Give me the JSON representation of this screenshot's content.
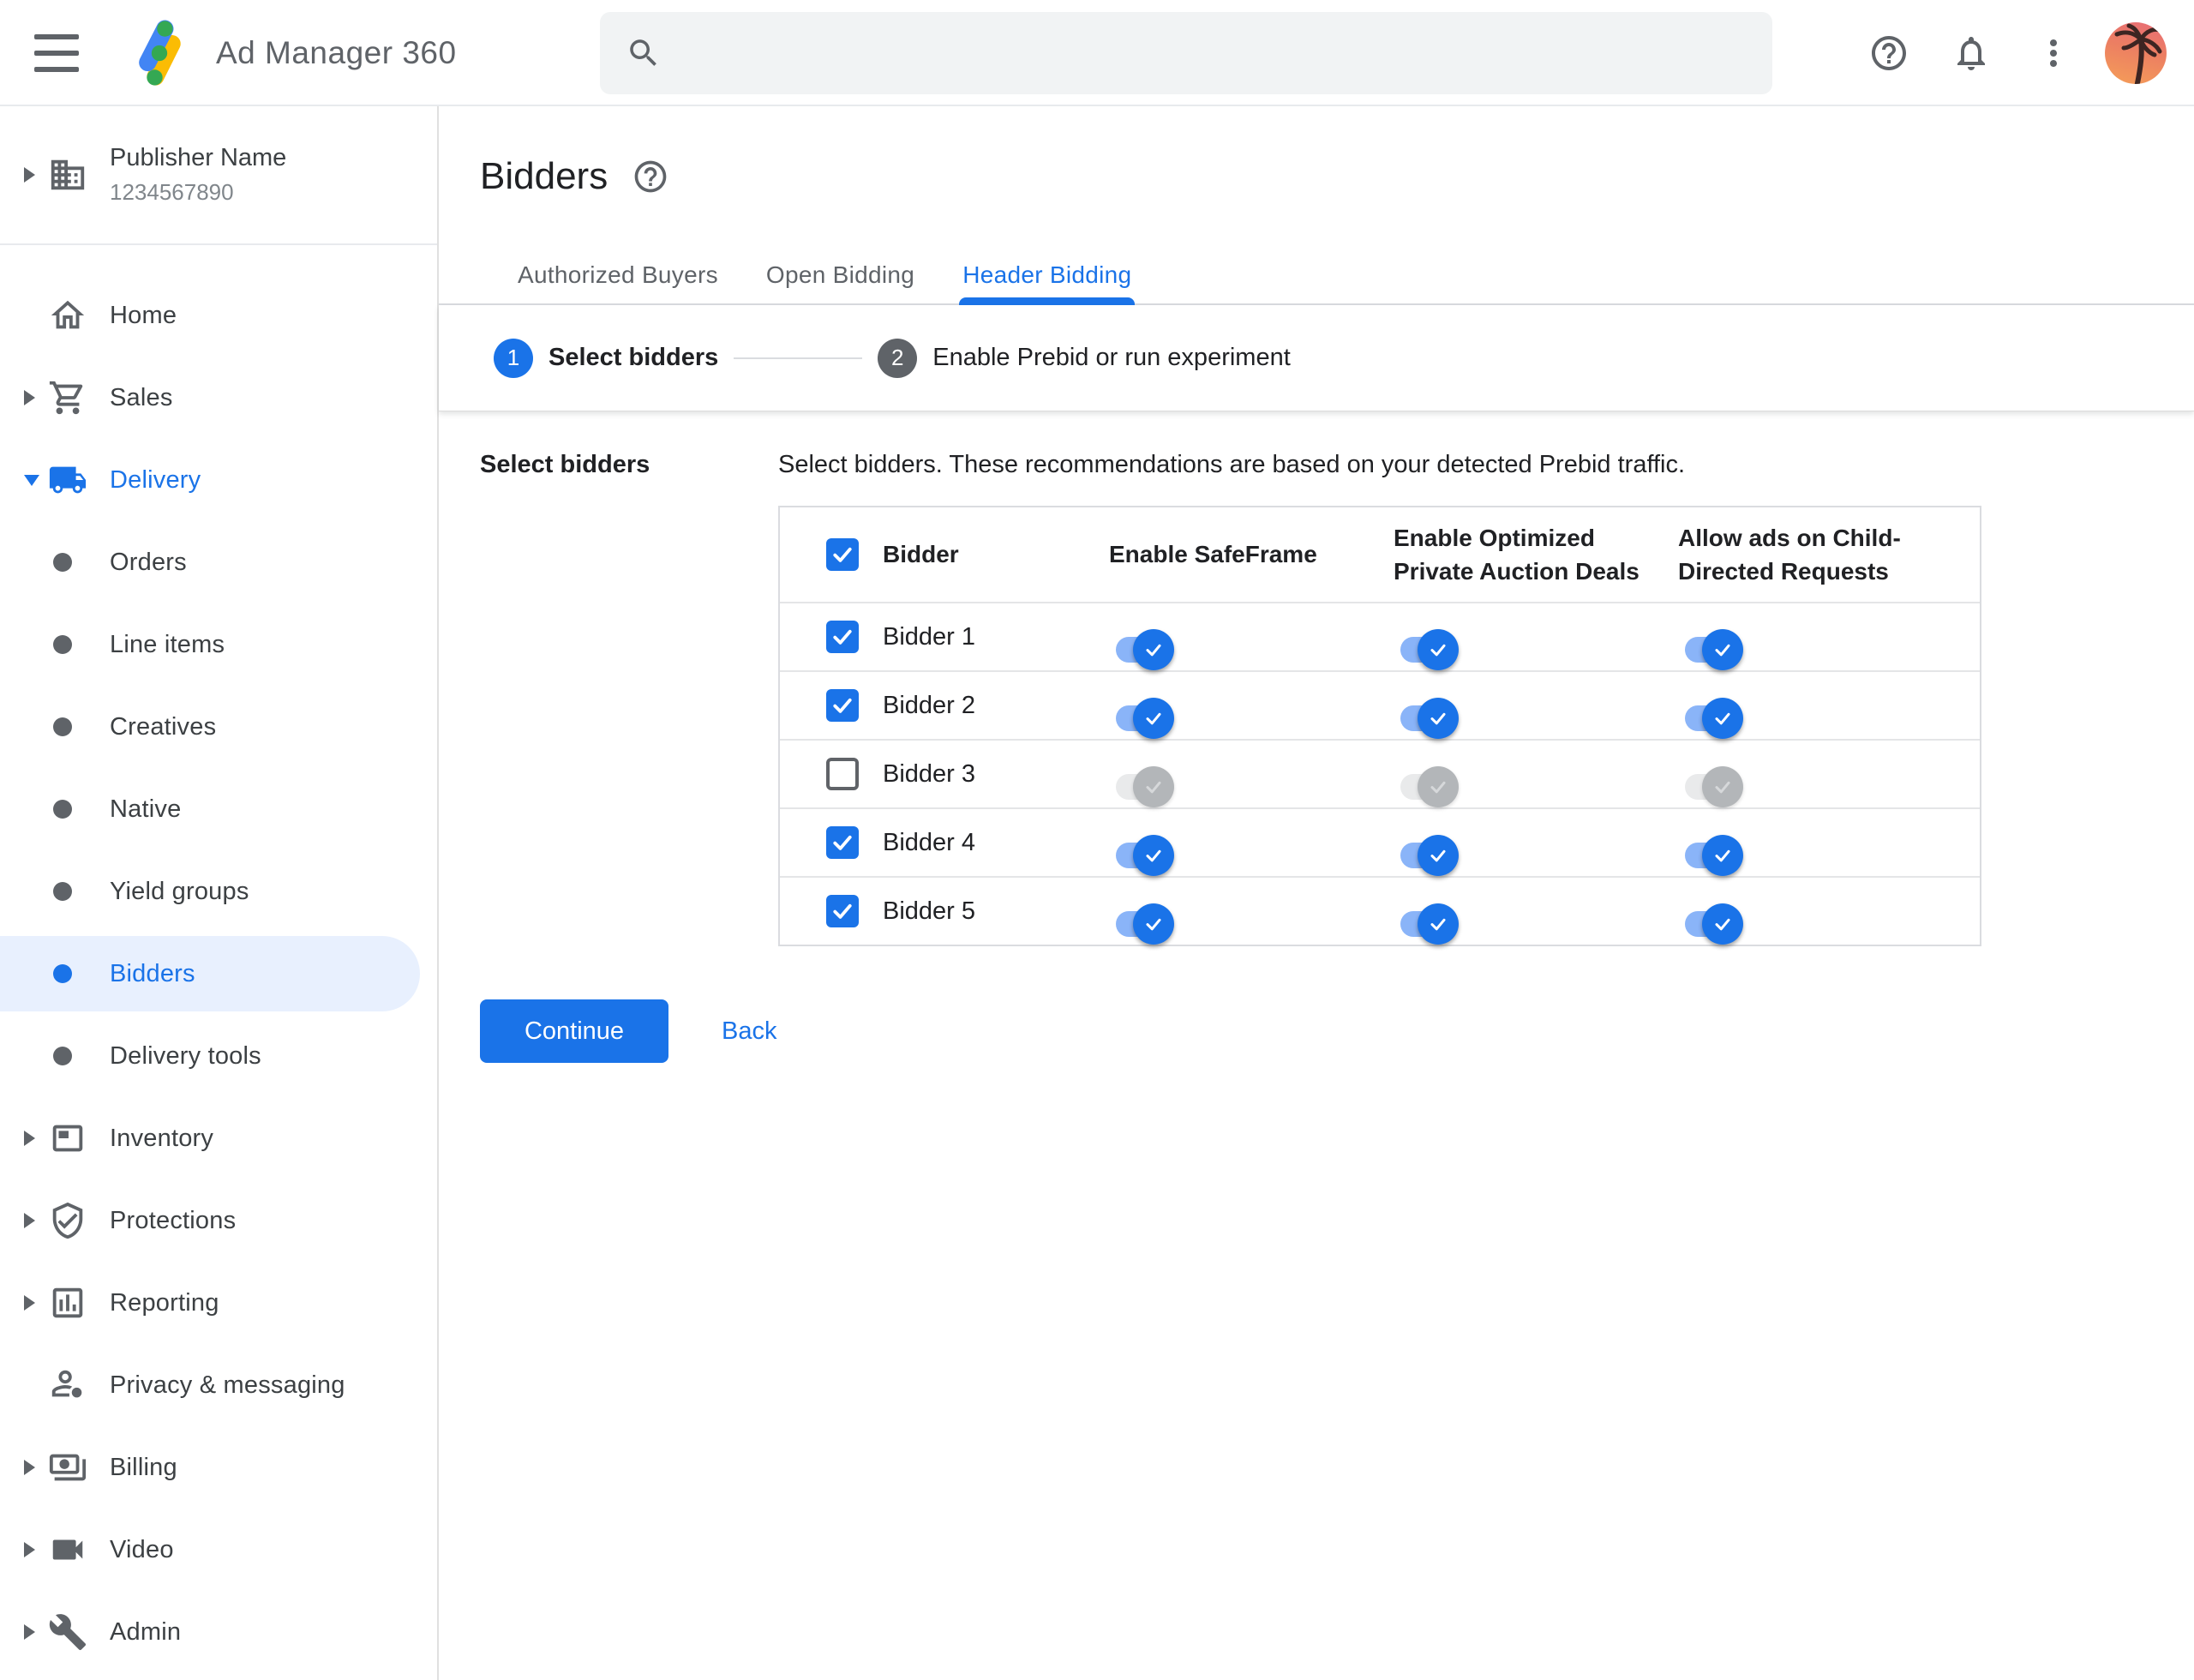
{
  "topbar": {
    "product_name": "Ad Manager 360",
    "search_placeholder": ""
  },
  "sidebar": {
    "publisher": {
      "name": "Publisher Name",
      "id": "1234567890"
    },
    "items": [
      {
        "label": "Home"
      },
      {
        "label": "Sales"
      },
      {
        "label": "Delivery"
      },
      {
        "label": "Orders"
      },
      {
        "label": "Line items"
      },
      {
        "label": "Creatives"
      },
      {
        "label": "Native"
      },
      {
        "label": "Yield groups"
      },
      {
        "label": "Bidders"
      },
      {
        "label": "Delivery tools"
      },
      {
        "label": "Inventory"
      },
      {
        "label": "Protections"
      },
      {
        "label": "Reporting"
      },
      {
        "label": "Privacy & messaging"
      },
      {
        "label": "Billing"
      },
      {
        "label": "Video"
      },
      {
        "label": "Admin"
      }
    ]
  },
  "main": {
    "title": "Bidders",
    "tabs": {
      "items": [
        "Authorized Buyers",
        "Open Bidding",
        "Header Bidding"
      ],
      "active_index": 2
    },
    "stepper": {
      "steps": [
        {
          "number": "1",
          "label": "Select bidders",
          "active": true
        },
        {
          "number": "2",
          "label": "Enable Prebid or run experiment",
          "active": false
        }
      ]
    },
    "section_label": "Select bidders",
    "description": "Select bidders. These recommendations are based on your detected Prebid traffic.",
    "table": {
      "select_all_checked": true,
      "columns": [
        "Bidder",
        "Enable SafeFrame",
        "Enable Optimized Private Auction Deals",
        "Allow ads on Child-Directed Requests"
      ],
      "rows": [
        {
          "name": "Bidder 1",
          "selected": true,
          "safeframe": true,
          "optimized_deals": true,
          "child_directed": true
        },
        {
          "name": "Bidder 2",
          "selected": true,
          "safeframe": true,
          "optimized_deals": true,
          "child_directed": true
        },
        {
          "name": "Bidder 3",
          "selected": false,
          "safeframe": false,
          "optimized_deals": false,
          "child_directed": false
        },
        {
          "name": "Bidder 4",
          "selected": true,
          "safeframe": true,
          "optimized_deals": true,
          "child_directed": true
        },
        {
          "name": "Bidder 5",
          "selected": true,
          "safeframe": true,
          "optimized_deals": true,
          "child_directed": true
        }
      ]
    },
    "actions": {
      "continue_label": "Continue",
      "back_label": "Back"
    }
  },
  "colors": {
    "accent_blue": "#1a73e8",
    "toggle_track_blue": "#8ab4f8",
    "selected_pill": "#e8f0fe",
    "grey_text": "#5f6368"
  }
}
